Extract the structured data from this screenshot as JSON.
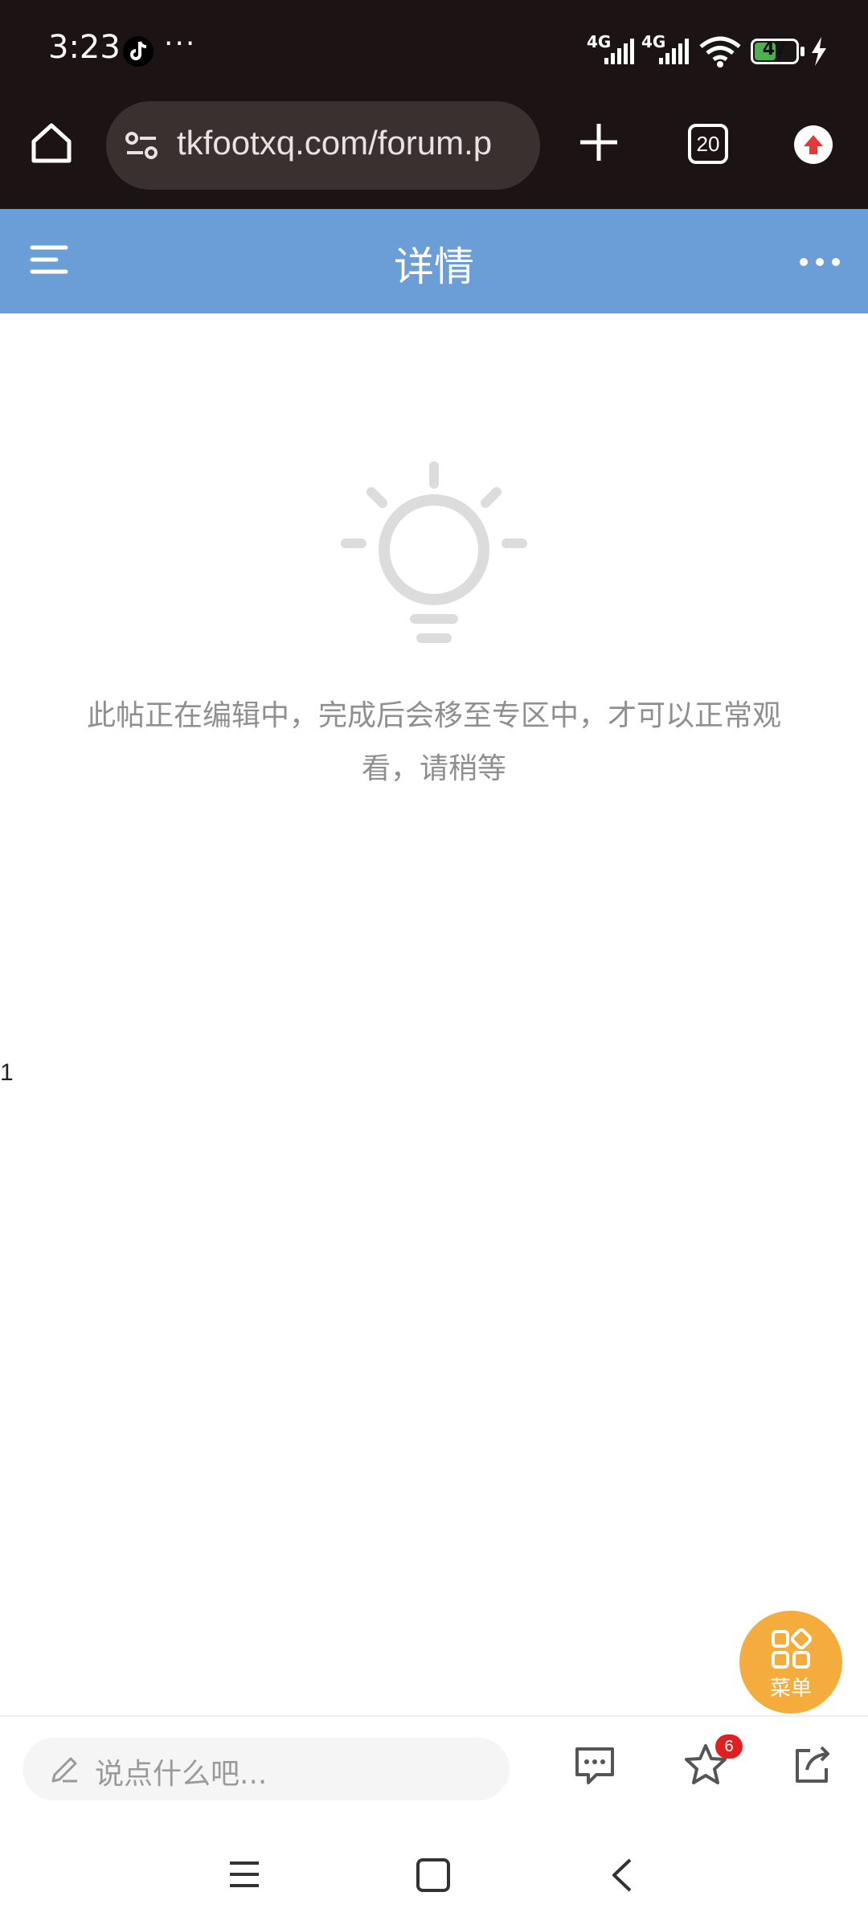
{
  "status_bar": {
    "time": "3:23",
    "overflow": "···",
    "signal1_label": "4G",
    "signal2_label": "4G",
    "battery_percent": "47",
    "icons": [
      "tiktok-icon",
      "signal-icon",
      "signal-icon",
      "wifi-icon",
      "battery-icon",
      "charging-icon"
    ]
  },
  "browser": {
    "url": "tkfootxq.com/forum.p",
    "tab_count": "20",
    "icons": [
      "home-icon",
      "site-settings-icon",
      "plus-icon",
      "tabs-icon",
      "update-icon"
    ]
  },
  "header": {
    "title": "详情",
    "background_color": "#6b9ed6",
    "icons": [
      "menu-icon",
      "more-icon"
    ]
  },
  "main": {
    "notice": "此帖正在编辑中，完成后会移至专区中，才可以正常观看，请稍等",
    "stray_text": "1",
    "icons": [
      "lightbulb-icon"
    ]
  },
  "fab": {
    "label": "菜单",
    "color": "#f4ac3c",
    "icon": "grid-icon"
  },
  "bottom_bar": {
    "comment_placeholder": "说点什么吧...",
    "favorite_badge": "6",
    "icons": [
      "pen-icon",
      "chat-icon",
      "star-icon",
      "share-icon"
    ]
  },
  "nav_bar": {
    "icons": [
      "recents-icon",
      "home-square-icon",
      "back-icon"
    ]
  }
}
